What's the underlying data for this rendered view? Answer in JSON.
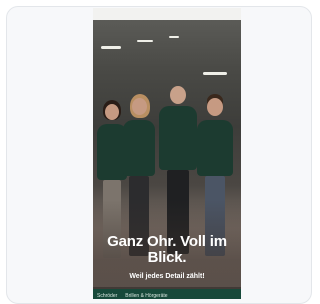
{
  "preview": {
    "headline": "Ganz Ohr. Voll im Blick.",
    "subline": "Weil jedes Detail zählt!",
    "nav_items": [
      "Schröder",
      "Brillen & Hörgeräte"
    ]
  }
}
